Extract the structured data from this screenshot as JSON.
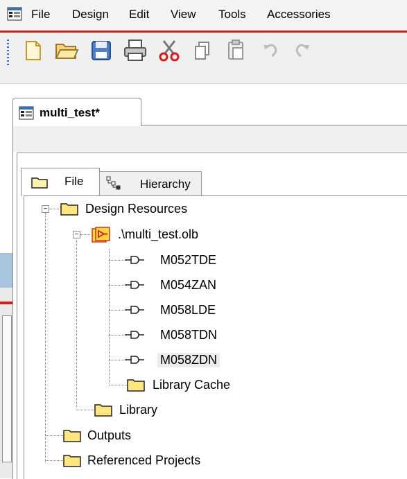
{
  "menubar": {
    "items": [
      "File",
      "Design",
      "Edit",
      "View",
      "Tools",
      "Accessories"
    ]
  },
  "toolbar": {
    "icons": [
      "new-icon",
      "open-icon",
      "save-icon",
      "print-icon",
      "cut-icon",
      "copy-icon",
      "paste-icon",
      "undo-icon",
      "redo-icon"
    ]
  },
  "document": {
    "tab_label": "multi_test*"
  },
  "panel_tabs": {
    "file": "File",
    "hierarchy": "Hierarchy"
  },
  "tree": {
    "root": "Design Resources",
    "library_file": ".\\multi_test.olb",
    "parts": [
      "M052TDE",
      "M054ZAN",
      "M058LDE",
      "M058TDN",
      "M058ZDN"
    ],
    "library_cache": "Library Cache",
    "library": "Library",
    "outputs": "Outputs",
    "referenced_projects": "Referenced Projects",
    "selected_part": "M058ZDN"
  },
  "colors": {
    "accent_red": "#d21d1d",
    "folder_yellow": "#ffe680",
    "menu_bg": "#f3f3f3"
  }
}
